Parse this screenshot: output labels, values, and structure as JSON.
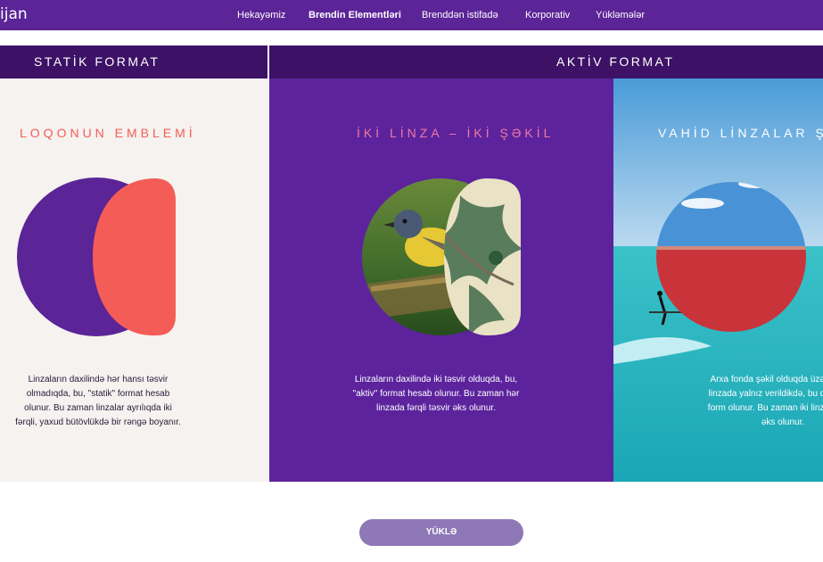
{
  "nav": {
    "logo": "ijan",
    "items": [
      "Hekayəmiz",
      "Brendin Elementləri",
      "Brenddən istifadə",
      "Korporativ",
      "Yükləmələr"
    ]
  },
  "sections": {
    "static_title": "STATİK FORMAT",
    "active_title": "AKTİV FORMAT"
  },
  "panels": {
    "static": {
      "title": "LOQONUN EMBLEMİ",
      "desc": "Linzaların daxilində hər hansı təsvir olmadıqda, bu, \"statik\" format hesab olunur. Bu zaman linzalar ayrılıqda iki fərqli, yaxud bütövlükdə bir rəngə boyanır."
    },
    "two_lens": {
      "title": "İKİ LİNZA – İKİ ŞƏKİL",
      "desc": "Linzaların daxilində iki təsvir olduqda, bu, \"aktiv\" format hesab olunur. Bu zaman hər linzada fərqli təsvir əks olunur."
    },
    "single_lens": {
      "title": "VAHİD LİNZALAR ŞƏK",
      "desc": "Arxa fonda şəkil olduqda üzərində iki linzada yalnız verildikdə, bu da \"aktiv\" form olunur. Bu zaman iki linzad təsvir əks olunur."
    }
  },
  "button": {
    "label": "YÜKLƏ"
  },
  "colors": {
    "nav_bg": "#5b2497",
    "section_header_bg": "#3d1266",
    "static_bg": "#f5f2ef",
    "active_bg": "#5c239d",
    "coral": "#f45c58",
    "purple": "#5b2497",
    "pink_title": "#f27aa0",
    "button_bg": "#8e78b6"
  },
  "icons": [
    "bird-lens-image",
    "pattern-lens-image",
    "sea-background-image",
    "red-lake-lens-image"
  ]
}
